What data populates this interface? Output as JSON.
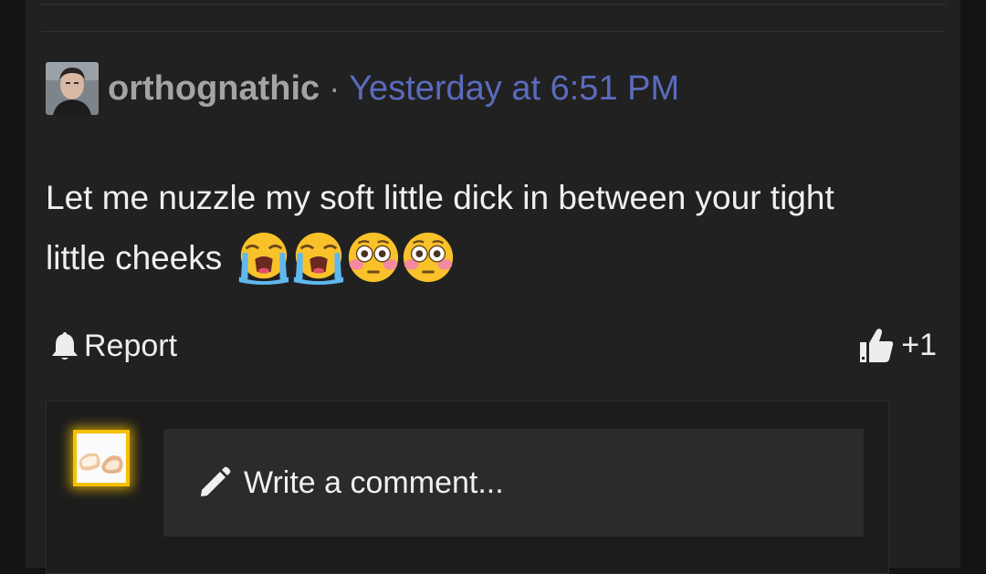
{
  "post": {
    "author": "orthognathic",
    "separator": "·",
    "timestamp": "Yesterday at 6:51 PM",
    "body_text": "Let me nuzzle my soft little dick in between your tight little cheeks",
    "emojis": [
      "loudly-crying-face",
      "loudly-crying-face",
      "flushed-face",
      "flushed-face"
    ]
  },
  "actions": {
    "report_label": "Report",
    "reaction_count": "+1",
    "report_icon": "bell-icon",
    "reaction_icon": "thumbs-up-icon"
  },
  "comment": {
    "placeholder": "Write a comment...",
    "icon": "pencil-icon"
  },
  "colors": {
    "background": "#212121",
    "username": "#a4a4a4",
    "timestamp": "#5b6bbd",
    "text": "#f0f0f0",
    "avatar_highlight": "#f5c000",
    "input_background": "#2b2b2b"
  }
}
